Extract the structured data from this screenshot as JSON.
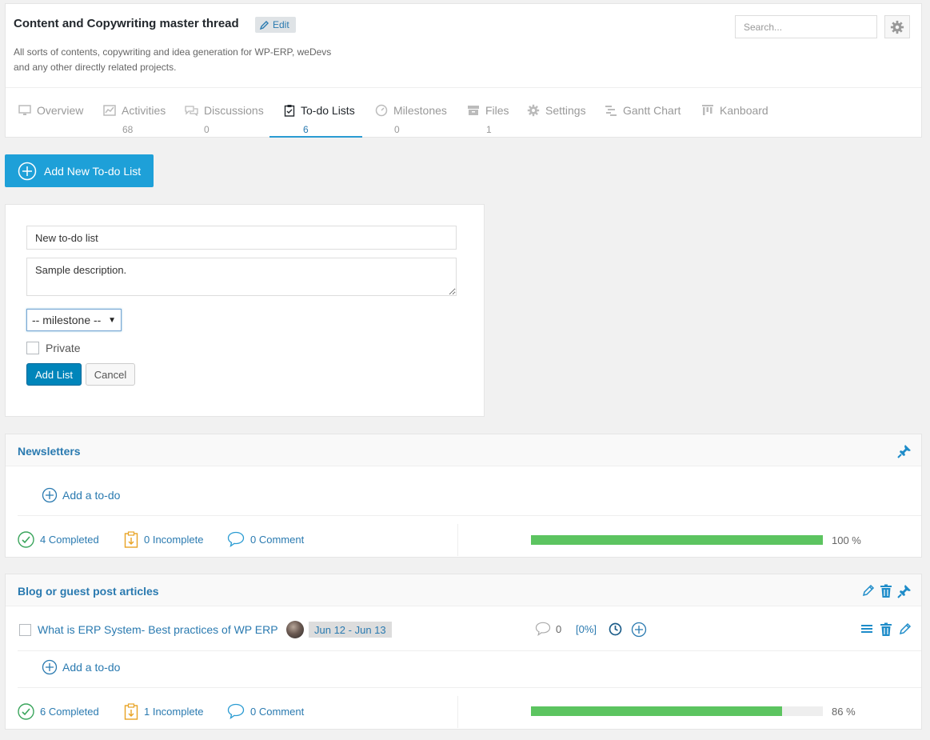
{
  "project": {
    "title": "Content and Copywriting master thread",
    "edit_label": "Edit",
    "description": "All sorts of contents, copywriting and idea generation for WP-ERP, weDevs and any other directly related projects.",
    "search_placeholder": "Search..."
  },
  "tabs": [
    {
      "label": "Overview",
      "count": "",
      "icon": "monitor-icon"
    },
    {
      "label": "Activities",
      "count": "68",
      "icon": "chart-icon"
    },
    {
      "label": "Discussions",
      "count": "0",
      "icon": "chat-icon"
    },
    {
      "label": "To-do Lists",
      "count": "6",
      "icon": "clipboard-icon",
      "active": true
    },
    {
      "label": "Milestones",
      "count": "0",
      "icon": "gauge-icon"
    },
    {
      "label": "Files",
      "count": "1",
      "icon": "archive-icon"
    },
    {
      "label": "Settings",
      "count": "",
      "icon": "gear-icon"
    },
    {
      "label": "Gantt Chart",
      "count": "",
      "icon": "gantt-icon"
    },
    {
      "label": "Kanboard",
      "count": "",
      "icon": "kanban-icon"
    }
  ],
  "add_list_button": "Add New To-do List",
  "form": {
    "name_value": "New to-do list",
    "description_value": "Sample description.",
    "milestone_selected": "-- milestone --",
    "private_label": "Private",
    "add_label": "Add List",
    "cancel_label": "Cancel"
  },
  "lists": [
    {
      "title": "Newsletters",
      "add_todo_label": "Add a to-do",
      "completed": "4 Completed",
      "incomplete": "0 Incomplete",
      "comments": "0 Comment",
      "progress": 100,
      "progress_label": "100 %"
    },
    {
      "title": "Blog or guest post articles",
      "add_todo_label": "Add a to-do",
      "completed": "6 Completed",
      "incomplete": "1 Incomplete",
      "comments": "0 Comment",
      "progress": 86,
      "progress_label": "86 %",
      "task": {
        "title": "What is ERP System- Best practices of WP ERP",
        "dates": "Jun 12 - Jun 13",
        "comment_count": "0",
        "percent": "[0%]"
      }
    }
  ],
  "colors": {
    "accent": "#1ea0d8",
    "link": "#2a7ab0",
    "progress": "#5cc460"
  }
}
